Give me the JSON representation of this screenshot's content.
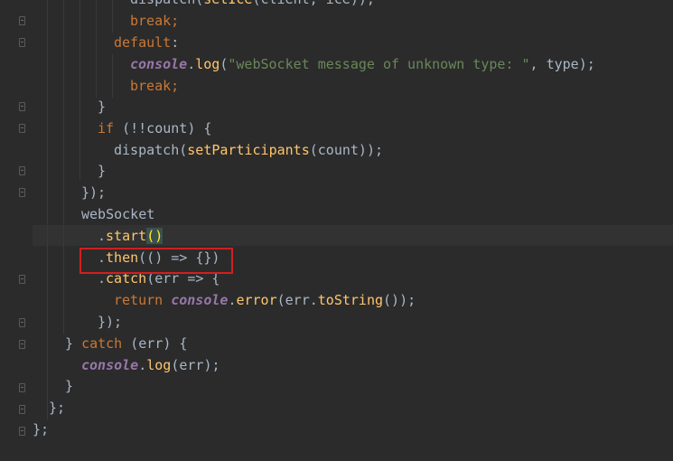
{
  "editor": {
    "lines": [
      {
        "segments": [
          {
            "t": "dispatch(",
            "c": ""
          },
          {
            "t": "setIce",
            "c": "fn"
          },
          {
            "t": "(client, ice));",
            "c": ""
          }
        ]
      },
      {
        "segments": [
          {
            "t": "break",
            "c": "kw"
          },
          {
            "t": ";",
            "c": "kw"
          }
        ]
      },
      {
        "segments": [
          {
            "t": "default",
            "c": "kw"
          },
          {
            "t": ":",
            "c": ""
          }
        ]
      },
      {
        "segments": [
          {
            "t": "console",
            "c": "con"
          },
          {
            "t": ".",
            "c": ""
          },
          {
            "t": "log",
            "c": "fn"
          },
          {
            "t": "(",
            "c": ""
          },
          {
            "t": "\"webSocket message of unknown type: \"",
            "c": "str"
          },
          {
            "t": ", type);",
            "c": ""
          }
        ]
      },
      {
        "segments": [
          {
            "t": "break",
            "c": "kw"
          },
          {
            "t": ";",
            "c": "kw"
          }
        ]
      },
      {
        "segments": [
          {
            "t": "}",
            "c": ""
          }
        ]
      },
      {
        "segments": [
          {
            "t": "if",
            "c": "kw"
          },
          {
            "t": " (!!count) {",
            "c": ""
          }
        ]
      },
      {
        "segments": [
          {
            "t": "dispatch(",
            "c": ""
          },
          {
            "t": "setParticipants",
            "c": "fn"
          },
          {
            "t": "(count));",
            "c": ""
          }
        ]
      },
      {
        "segments": [
          {
            "t": "}",
            "c": ""
          }
        ]
      },
      {
        "segments": [
          {
            "t": "});",
            "c": ""
          }
        ]
      },
      {
        "segments": [
          {
            "t": "webSocket",
            "c": ""
          }
        ]
      },
      {
        "segments": [
          {
            "t": ".",
            "c": ""
          },
          {
            "t": "start",
            "c": "fn"
          },
          {
            "t": "()",
            "c": "paren-hl"
          }
        ]
      },
      {
        "segments": [
          {
            "t": ".",
            "c": ""
          },
          {
            "t": "then",
            "c": "fn"
          },
          {
            "t": "(() => {})",
            "c": ""
          }
        ]
      },
      {
        "segments": [
          {
            "t": ".",
            "c": ""
          },
          {
            "t": "catch",
            "c": "fn"
          },
          {
            "t": "(err => {",
            "c": ""
          }
        ]
      },
      {
        "segments": [
          {
            "t": "return ",
            "c": "kw"
          },
          {
            "t": "console",
            "c": "con"
          },
          {
            "t": ".",
            "c": ""
          },
          {
            "t": "error",
            "c": "fn"
          },
          {
            "t": "(err.",
            "c": ""
          },
          {
            "t": "toString",
            "c": "fn"
          },
          {
            "t": "());",
            "c": ""
          }
        ]
      },
      {
        "segments": [
          {
            "t": "});",
            "c": ""
          }
        ]
      },
      {
        "segments": [
          {
            "t": "} ",
            "c": ""
          },
          {
            "t": "catch",
            "c": "kw"
          },
          {
            "t": " (err) {",
            "c": ""
          }
        ]
      },
      {
        "segments": [
          {
            "t": "console",
            "c": "con"
          },
          {
            "t": ".",
            "c": ""
          },
          {
            "t": "log",
            "c": "fn"
          },
          {
            "t": "(err);",
            "c": ""
          }
        ]
      },
      {
        "segments": [
          {
            "t": "}",
            "c": ""
          }
        ]
      },
      {
        "segments": [
          {
            "t": "};",
            "c": ""
          }
        ]
      },
      {
        "segments": [
          {
            "t": "};",
            "c": ""
          }
        ]
      }
    ]
  }
}
